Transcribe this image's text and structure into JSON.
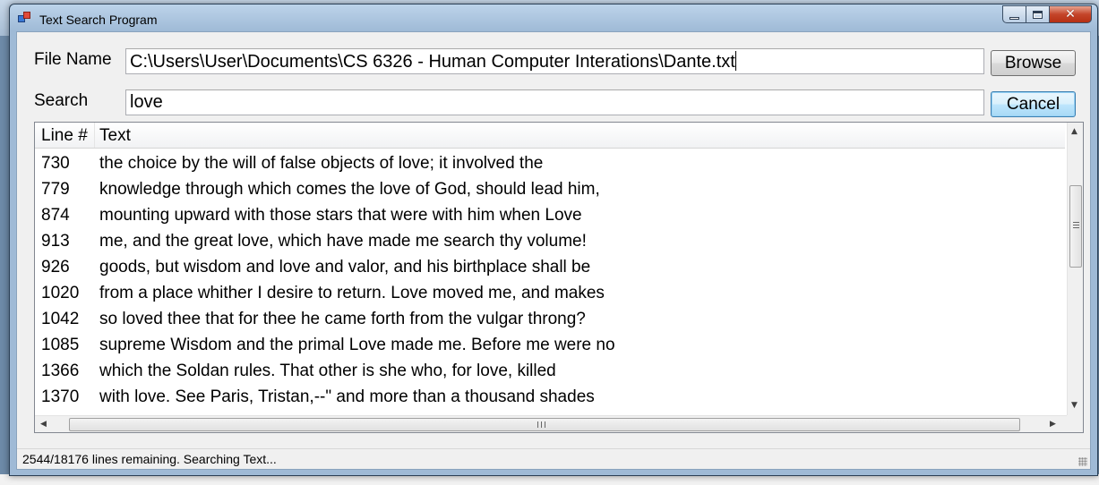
{
  "window": {
    "title": "Text Search Program"
  },
  "form": {
    "file_name_label": "File Name",
    "file_name_value": "C:\\Users\\User\\Documents\\CS 6326 - Human Computer Interations\\Dante.txt",
    "browse_label": "Browse",
    "search_label": "Search",
    "search_value": "love",
    "cancel_label": "Cancel"
  },
  "results": {
    "columns": [
      "Line #",
      "Text"
    ],
    "rows": [
      {
        "line": "730",
        "text": "the choice by the will of false objects of love; it involved the"
      },
      {
        "line": "779",
        "text": "knowledge through which comes the love of God, should lead him,"
      },
      {
        "line": "874",
        "text": "mounting upward with those stars that were with him when Love"
      },
      {
        "line": "913",
        "text": "me, and the great love, which have made me search thy volume!"
      },
      {
        "line": "926",
        "text": "goods, but wisdom and love and valor, and his birthplace shall be"
      },
      {
        "line": "1020",
        "text": "from a place whither I desire to return. Love moved me, and makes"
      },
      {
        "line": "1042",
        "text": "so loved thee that for thee he came forth from the vulgar throng?"
      },
      {
        "line": "1085",
        "text": "supreme Wisdom and the primal Love made me. Before me were no"
      },
      {
        "line": "1366",
        "text": "which the Soldan rules. That other is she who, for love, killed"
      },
      {
        "line": "1370",
        "text": "with love. See Paris, Tristan,--\" and more than a thousand shades"
      }
    ]
  },
  "status": {
    "text": "2544/18176 lines remaining. Searching Text..."
  },
  "icons": {
    "app": "app-icon",
    "minimize": "minimize-icon",
    "maximize": "maximize-icon",
    "close": "close-icon"
  },
  "colors": {
    "window_frame": "#9fbad6",
    "close_button": "#c4452a",
    "client_bg": "#f0f0f0",
    "focused_button": "#3c7fb1"
  }
}
